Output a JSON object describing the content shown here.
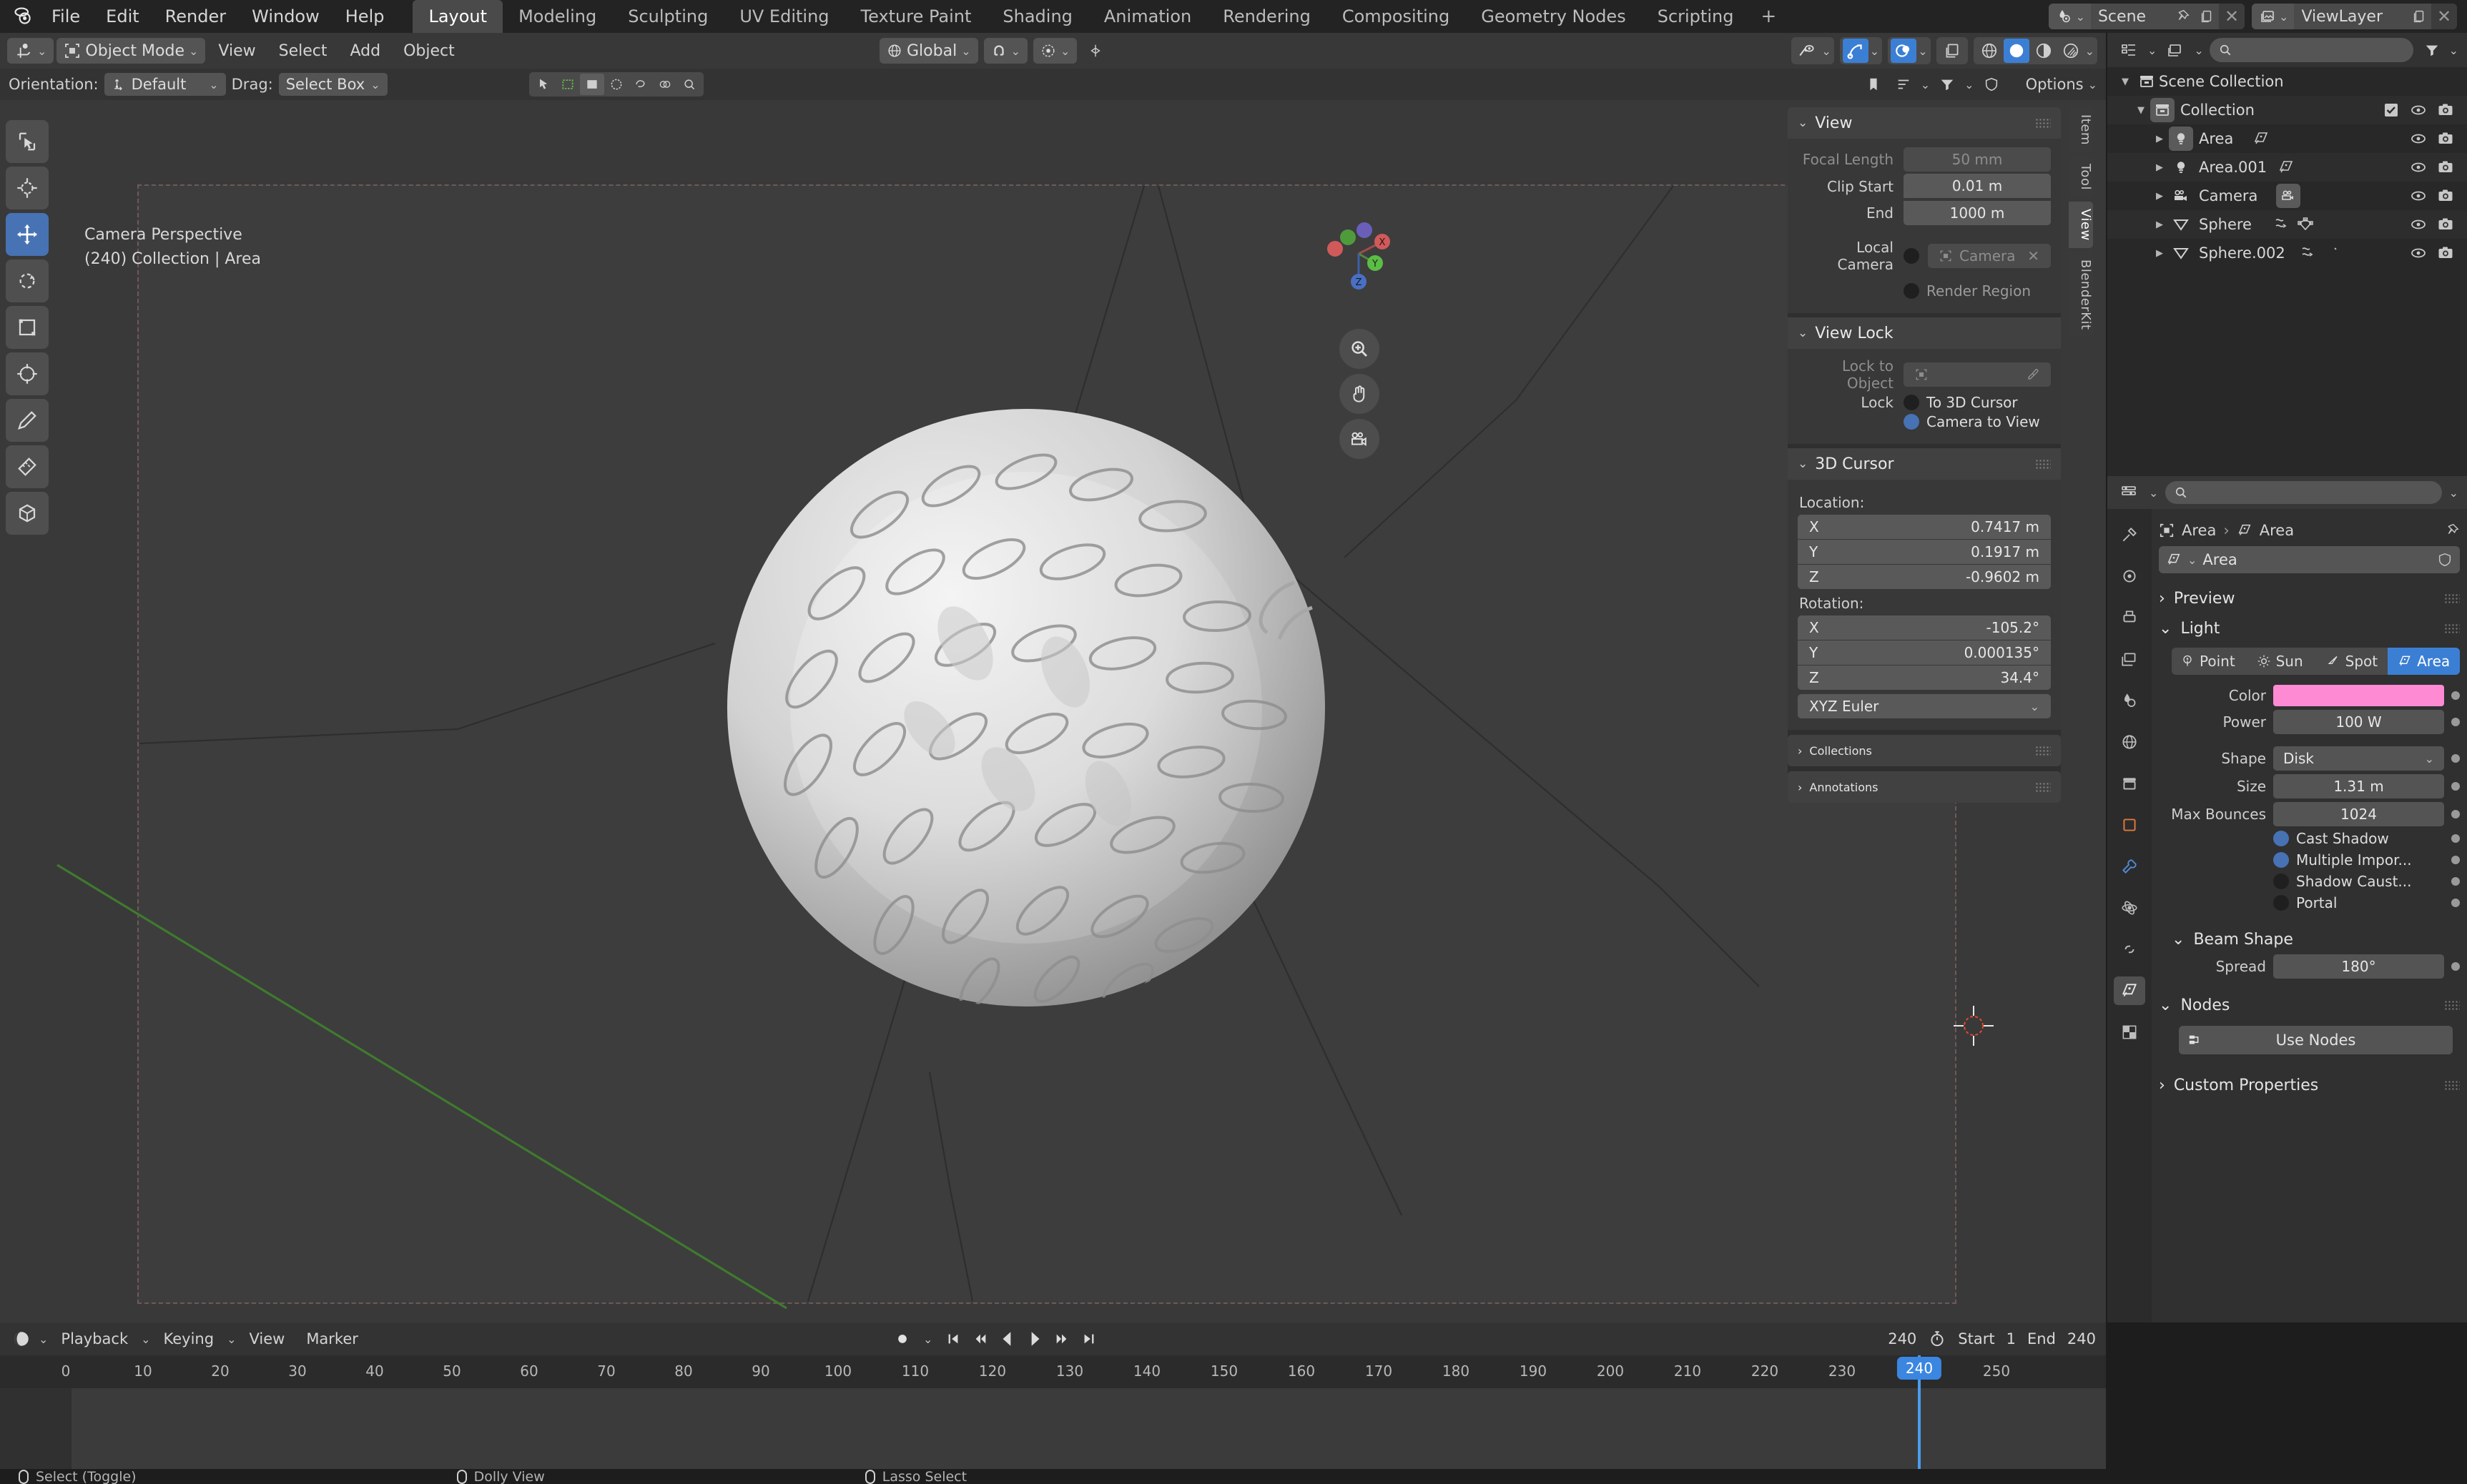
{
  "app": {
    "logo_icon": "blender-logo-icon",
    "menus": [
      "File",
      "Edit",
      "Render",
      "Window",
      "Help"
    ],
    "workspaces": [
      {
        "label": "Layout",
        "active": true
      },
      {
        "label": "Modeling",
        "active": false
      },
      {
        "label": "Sculpting",
        "active": false
      },
      {
        "label": "UV Editing",
        "active": false
      },
      {
        "label": "Texture Paint",
        "active": false
      },
      {
        "label": "Shading",
        "active": false
      },
      {
        "label": "Animation",
        "active": false
      },
      {
        "label": "Rendering",
        "active": false
      },
      {
        "label": "Compositing",
        "active": false
      },
      {
        "label": "Geometry Nodes",
        "active": false
      },
      {
        "label": "Scripting",
        "active": false
      }
    ],
    "add_workspace_label": "+",
    "scene": {
      "name": "Scene",
      "icon": "scene-icon",
      "pin_icon": "pin-icon",
      "copy_icon": "new-scene-icon",
      "close_icon": "close-icon"
    },
    "view_layer": {
      "name": "ViewLayer",
      "icon": "viewlayer-icon",
      "copy_icon": "new-viewlayer-icon",
      "close_icon": "close-icon"
    }
  },
  "viewport_header": {
    "editor_type_icon": "editor-type-3dview-icon",
    "mode": "Object Mode",
    "mode_icon": "object-mode-icon",
    "menus": [
      "View",
      "Select",
      "Add",
      "Object"
    ],
    "transform_orientation": "Global",
    "snap_icon": "magnet-icon",
    "proportional_icon": "proportional-edit-icon",
    "visibility_icon": "visibility-icon",
    "gizmo_icon": "gizmo-icon",
    "overlays_icon": "overlays-icon",
    "xray_icon": "xray-icon",
    "shading_modes": [
      "wireframe",
      "solid",
      "material-preview",
      "rendered"
    ],
    "shading_active": "solid"
  },
  "tool_settings": {
    "orientation_label": "Orientation:",
    "orientation_value": "Default",
    "orientation_icon": "orientation-icon",
    "drag_label": "Drag:",
    "drag_value": "Select Box",
    "options_label": "Options",
    "mode_icons": [
      "tweak-icon",
      "select-box-icon",
      "select-circle-icon",
      "select-lasso-icon"
    ],
    "extra_icons": [
      "snap-vertex-icon",
      "snap-edge-icon",
      "snap-face-icon",
      "snap-volume-icon",
      "zoom-region-icon"
    ],
    "filter_icons": [
      "bookmark-icon",
      "sort-icon",
      "filter-icon",
      "shield-icon"
    ]
  },
  "toolbar": {
    "tools": [
      {
        "name": "tweak-tool",
        "icon": "cursor-select-icon",
        "active": false
      },
      {
        "name": "cursor-tool",
        "icon": "3d-cursor-icon",
        "active": false
      },
      {
        "name": "move-tool",
        "icon": "move-arrows-icon",
        "active": true
      },
      {
        "name": "rotate-tool",
        "icon": "rotate-icon",
        "active": false
      },
      {
        "name": "scale-tool",
        "icon": "scale-icon",
        "active": false
      },
      {
        "name": "transform-tool",
        "icon": "transform-icon",
        "active": false
      },
      {
        "name": "annotate-tool",
        "icon": "pencil-icon",
        "active": false
      },
      {
        "name": "measure-tool",
        "icon": "ruler-icon",
        "active": false
      },
      {
        "name": "add-cube-tool",
        "icon": "add-cube-icon",
        "active": false
      }
    ]
  },
  "viewport": {
    "overlay_line1": "Camera Perspective",
    "overlay_line2": "(240) Collection | Area",
    "gizmo_axes": [
      "X",
      "Y",
      "Z"
    ],
    "nav_icons": [
      "zoom-icon",
      "pan-hand-icon",
      "camera-view-icon"
    ]
  },
  "npanel": {
    "tabs": [
      {
        "label": "Item",
        "active": false
      },
      {
        "label": "Tool",
        "active": false
      },
      {
        "label": "View",
        "active": true
      },
      {
        "label": "BlenderKit",
        "active": false
      }
    ],
    "view_panel": {
      "title": "View",
      "focal_length_label": "Focal Length",
      "focal_length_value": "50 mm",
      "clip_start_label": "Clip Start",
      "clip_start_value": "0.01 m",
      "clip_end_label": "End",
      "clip_end_value": "1000 m",
      "local_camera_label": "Local Camera",
      "local_camera_value": "Camera",
      "render_region_label": "Render Region",
      "render_region_on": false,
      "local_camera_on": false
    },
    "view_lock": {
      "title": "View Lock",
      "lock_to_object_label": "Lock to Object",
      "lock_to_object_value": "",
      "lock_label": "Lock",
      "to_3d_cursor_label": "To 3D Cursor",
      "to_3d_cursor_on": false,
      "camera_to_view_label": "Camera to View",
      "camera_to_view_on": true
    },
    "cursor_3d": {
      "title": "3D Cursor",
      "location_label": "Location:",
      "location": [
        {
          "axis": "X",
          "value": "0.7417 m"
        },
        {
          "axis": "Y",
          "value": "0.1917 m"
        },
        {
          "axis": "Z",
          "value": "-0.9602 m"
        }
      ],
      "rotation_label": "Rotation:",
      "rotation": [
        {
          "axis": "X",
          "value": "-105.2°"
        },
        {
          "axis": "Y",
          "value": "0.000135°"
        },
        {
          "axis": "Z",
          "value": "34.4°"
        }
      ],
      "rotation_mode": "XYZ Euler"
    },
    "collections_title": "Collections",
    "annotations_title": "Annotations"
  },
  "outliner": {
    "editor_icon": "outliner-icon",
    "display_mode_icon": "view-layer-icon",
    "search_placeholder": "",
    "filter_icon": "filter-icon",
    "scene_collection": "Scene Collection",
    "rows": [
      {
        "name": "Collection",
        "icon": "collection-icon",
        "indent": 1,
        "expanded": true,
        "has_checkbox": true,
        "checked": true,
        "extra_icons": [],
        "highlight_icon": true
      },
      {
        "name": "Area",
        "icon": "light-icon",
        "indent": 2,
        "expanded": false,
        "has_checkbox": false,
        "extra_icons": [
          "area-light-data-icon"
        ],
        "highlight_icon": true
      },
      {
        "name": "Area.001",
        "icon": "light-icon",
        "indent": 2,
        "expanded": false,
        "has_checkbox": false,
        "extra_icons": [
          "area-light-data-icon"
        ],
        "highlight_icon": false
      },
      {
        "name": "Camera",
        "icon": "camera-icon",
        "indent": 2,
        "expanded": false,
        "has_checkbox": false,
        "extra_icons": [
          "camera-data-icon"
        ],
        "highlight_icon": false
      },
      {
        "name": "Sphere",
        "icon": "mesh-icon",
        "indent": 2,
        "expanded": false,
        "has_checkbox": false,
        "extra_icons": [
          "modifier-icon",
          "mesh-data-icon"
        ],
        "highlight_icon": false
      },
      {
        "name": "Sphere.002",
        "icon": "mesh-icon",
        "indent": 2,
        "expanded": false,
        "has_checkbox": false,
        "extra_icons": [
          "modifier-icon",
          "mesh-data-icon"
        ],
        "highlight_icon": false
      }
    ],
    "row_icons": {
      "eye": "eye-icon",
      "camera": "render-camera-icon"
    }
  },
  "properties": {
    "editor_icon": "properties-icon",
    "search_placeholder": "",
    "breadcrumb": [
      {
        "label": "Area",
        "icon": "object-icon"
      },
      {
        "label": "Area",
        "icon": "light-data-icon"
      }
    ],
    "pin_icon": "pin-icon",
    "id_name": "Area",
    "id_icon": "light-data-icon",
    "shield_icon": "shield-icon",
    "tabs": [
      {
        "name": "tool",
        "icon": "tool-icon",
        "active": false
      },
      {
        "name": "render",
        "icon": "render-icon",
        "active": false
      },
      {
        "name": "output",
        "icon": "printer-icon",
        "active": false
      },
      {
        "name": "view-layer",
        "icon": "images-icon",
        "active": false
      },
      {
        "name": "scene",
        "icon": "scene-icon",
        "active": false
      },
      {
        "name": "world",
        "icon": "world-icon",
        "active": false
      },
      {
        "name": "collection",
        "icon": "collection-props-icon",
        "active": false
      },
      {
        "name": "object",
        "icon": "object-props-icon",
        "active": false
      },
      {
        "name": "modifiers",
        "icon": "wrench-icon",
        "active": false
      },
      {
        "name": "physics",
        "icon": "physics-icon",
        "active": false
      },
      {
        "name": "constraints",
        "icon": "constraint-icon",
        "active": false
      },
      {
        "name": "data",
        "icon": "light-data-icon",
        "active": true
      },
      {
        "name": "texture",
        "icon": "checker-icon",
        "active": false
      }
    ],
    "preview_title": "Preview",
    "light_title": "Light",
    "light_types": [
      {
        "label": "Point",
        "icon": "point-light-icon",
        "active": false
      },
      {
        "label": "Sun",
        "icon": "sun-light-icon",
        "active": false
      },
      {
        "label": "Spot",
        "icon": "spot-light-icon",
        "active": false
      },
      {
        "label": "Area",
        "icon": "area-light-icon",
        "active": true
      }
    ],
    "color_label": "Color",
    "color_value": "#FF8AD4",
    "power_label": "Power",
    "power_value": "100 W",
    "shape_label": "Shape",
    "shape_value": "Disk",
    "size_label": "Size",
    "size_value": "1.31 m",
    "max_bounces_label": "Max Bounces",
    "max_bounces_value": "1024",
    "toggles": [
      {
        "label": "Cast Shadow",
        "on": true
      },
      {
        "label": "Multiple Impor...",
        "on": true
      },
      {
        "label": "Shadow Caust...",
        "on": false
      },
      {
        "label": "Portal",
        "on": false
      }
    ],
    "beam_shape_title": "Beam Shape",
    "spread_label": "Spread",
    "spread_value": "180°",
    "nodes_title": "Nodes",
    "use_nodes_label": "Use Nodes",
    "use_nodes_icon": "nodetree-icon",
    "custom_properties_title": "Custom Properties"
  },
  "timeline": {
    "editor_icon": "timeline-icon",
    "menus": [
      "Playback",
      "Keying",
      "View",
      "Marker"
    ],
    "record_icon": "record-icon",
    "transport": [
      "jump-start-icon",
      "prev-keyframe-icon",
      "play-reverse-icon",
      "play-icon",
      "next-keyframe-icon",
      "jump-end-icon"
    ],
    "current_frame": "240",
    "autokey_icon": "stopwatch-icon",
    "start_label": "Start",
    "start_value": "1",
    "end_label": "End",
    "end_value": "240",
    "playhead_frame": "240",
    "ruler_ticks": [
      "0",
      "10",
      "20",
      "30",
      "40",
      "50",
      "60",
      "70",
      "80",
      "90",
      "100",
      "110",
      "120",
      "130",
      "140",
      "150",
      "160",
      "170",
      "180",
      "190",
      "200",
      "210",
      "220",
      "230",
      "240",
      "250"
    ]
  },
  "status_bar": {
    "items": [
      {
        "label": "Select (Toggle)",
        "icon": "mouse-left-icon"
      },
      {
        "label": "Dolly View",
        "icon": "mouse-middle-icon"
      },
      {
        "label": "Lasso Select",
        "icon": "mouse-right-icon"
      }
    ]
  },
  "colors": {
    "accent_blue": "#4772b3",
    "bright_blue": "#3b86e0",
    "light_pink": "#FF8AD4",
    "panel_bg": "#383838",
    "viewport_bg": "#393939"
  }
}
